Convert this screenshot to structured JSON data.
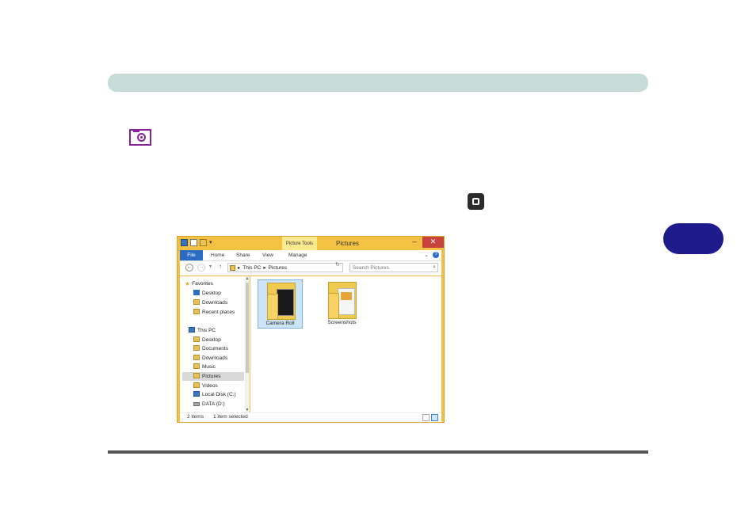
{
  "explorer": {
    "window_title": "Pictures",
    "context_tab": "Picture Tools",
    "ribbon_tabs": [
      "File",
      "Home",
      "Share",
      "View",
      "Manage"
    ],
    "window_buttons": {
      "minimize": "–",
      "maximize": "☐",
      "close": "✕"
    },
    "address": {
      "root": "This PC",
      "sep": "▸",
      "current": "Pictures"
    },
    "search_placeholder": "Search Pictures",
    "nav": {
      "favorites": "Favorites",
      "fav_items": [
        "Desktop",
        "Downloads",
        "Recent places"
      ],
      "this_pc": "This PC",
      "pc_items": [
        "Desktop",
        "Documents",
        "Downloads",
        "Music",
        "Pictures",
        "Videos",
        "Local Disk (C:)",
        "DATA (D:)"
      ]
    },
    "folders": [
      "Camera Roll",
      "Screenshots"
    ],
    "status": {
      "count": "2 items",
      "selected": "1 item selected"
    }
  },
  "icons": {
    "page_icon": "camera-icon",
    "inline_icon": "stop-icon"
  },
  "colors": {
    "header_band": "#c6dcd8",
    "chapter_tab": "#1f1b8c",
    "icon_accent": "#8b1f9e",
    "explorer_frame": "#f4c242",
    "file_tab": "#2a6cc4"
  }
}
